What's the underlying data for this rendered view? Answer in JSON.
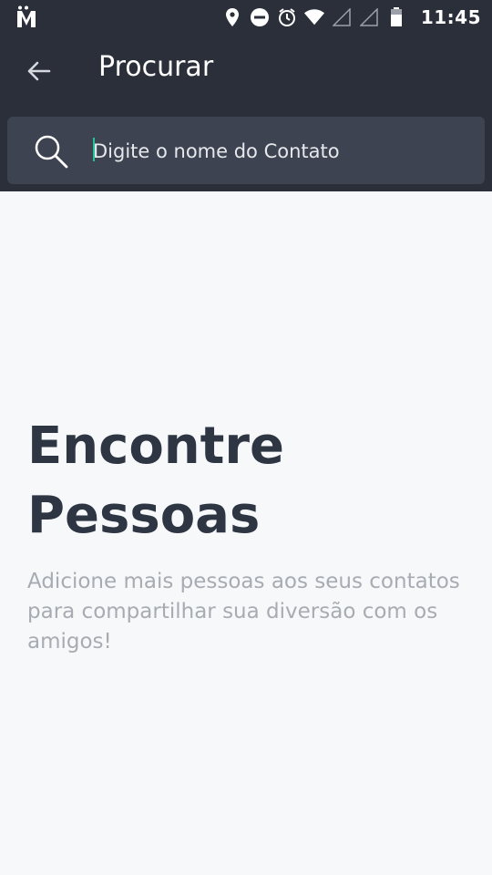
{
  "status_bar": {
    "time": "11:45",
    "icons": [
      "app-logo-icon",
      "location-icon",
      "do-not-disturb-icon",
      "alarm-icon",
      "wifi-icon",
      "signal-icon",
      "signal-icon",
      "battery-icon"
    ]
  },
  "appbar": {
    "title": "Procurar",
    "back_icon": "arrow-left-icon"
  },
  "search": {
    "placeholder": "Digite o nome do Contato",
    "value": ""
  },
  "empty_state": {
    "headline": "Encontre Pessoas",
    "description": "Adicione mais pessoas aos seus contatos para compartilhar sua diversão com os amigos!"
  },
  "colors": {
    "header_bg": "#2A2F3A",
    "search_bg": "#3D4350",
    "page_bg": "#F7F8FA",
    "headline": "#2E3644",
    "subtext": "#A7ABB2",
    "caret": "#22C39A"
  }
}
